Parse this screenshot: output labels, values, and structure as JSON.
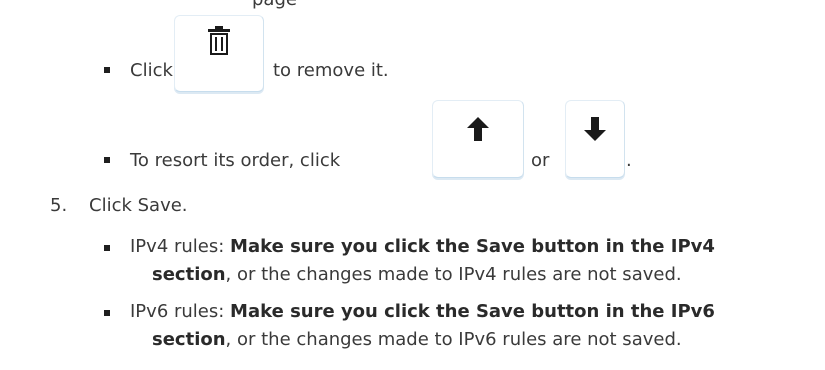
{
  "partial_top_text": "page",
  "items": {
    "remove": {
      "before": "Click",
      "after": "to remove it."
    },
    "resort": {
      "before": "To resort its order, click",
      "or": "or",
      "end": "."
    }
  },
  "step5": {
    "number": "5.",
    "text": "Click Save.",
    "ipv4": {
      "label": "IPv4 rules: ",
      "bold1": "Make sure you click the Save button in the IPv4",
      "bold2": "section",
      "rest": ", or the changes made to IPv4 rules are not saved."
    },
    "ipv6": {
      "label": "IPv6 rules: ",
      "bold1": "Make sure you click the Save button in the IPv6",
      "bold2": "section",
      "rest": ", or the changes made to IPv6 rules are not saved."
    }
  },
  "icons": {
    "delete": "trash-icon",
    "up": "arrow-up-icon",
    "down": "arrow-down-icon"
  },
  "colors": {
    "text": "#3a3a3a",
    "icon": "#1a1a1a",
    "button_border": "#c7dded"
  }
}
